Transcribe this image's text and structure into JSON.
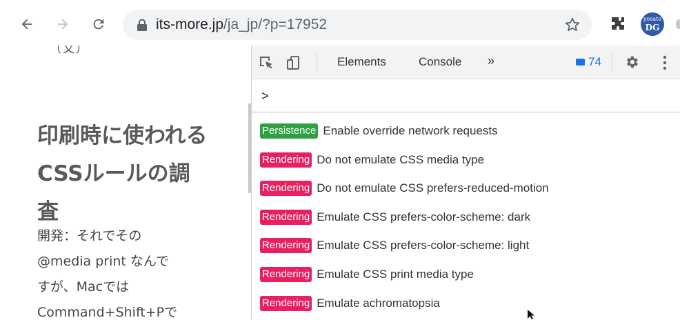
{
  "browser": {
    "url_domain": "its-more.jp",
    "url_path": "/ja_jp/?p=17952",
    "avatar_line1": "yosato",
    "avatar_line2": "DG",
    "icons": [
      "back-arrow-icon",
      "forward-arrow-icon",
      "reload-icon",
      "lock-icon",
      "star-icon",
      "puzzle-icon"
    ]
  },
  "page": {
    "clipped_top_text": "（又）",
    "title_lines": [
      "印刷時に使われる",
      "CSSルールの調",
      "査"
    ],
    "body_lines": [
      "開発：それでその",
      "@media print なんで",
      "すが、Macでは",
      "Command+Shift+Pで"
    ]
  },
  "devtools": {
    "tabs": [
      {
        "label": "Elements"
      },
      {
        "label": "Console"
      }
    ],
    "more_tabs": "»",
    "issues_count": "74",
    "command_input_value": ">",
    "colors": {
      "persistence": "#2ea043",
      "rendering": "#e8205f",
      "issues": "#1a73e8"
    },
    "commands": [
      {
        "category": "Persistence",
        "label": "Enable override network requests"
      },
      {
        "category": "Rendering",
        "label": "Do not emulate CSS media type"
      },
      {
        "category": "Rendering",
        "label": "Do not emulate CSS prefers-reduced-motion"
      },
      {
        "category": "Rendering",
        "label": "Emulate CSS prefers-color-scheme: dark"
      },
      {
        "category": "Rendering",
        "label": "Emulate CSS prefers-color-scheme: light"
      },
      {
        "category": "Rendering",
        "label": "Emulate CSS print media type"
      },
      {
        "category": "Rendering",
        "label": "Emulate achromatopsia"
      }
    ]
  }
}
